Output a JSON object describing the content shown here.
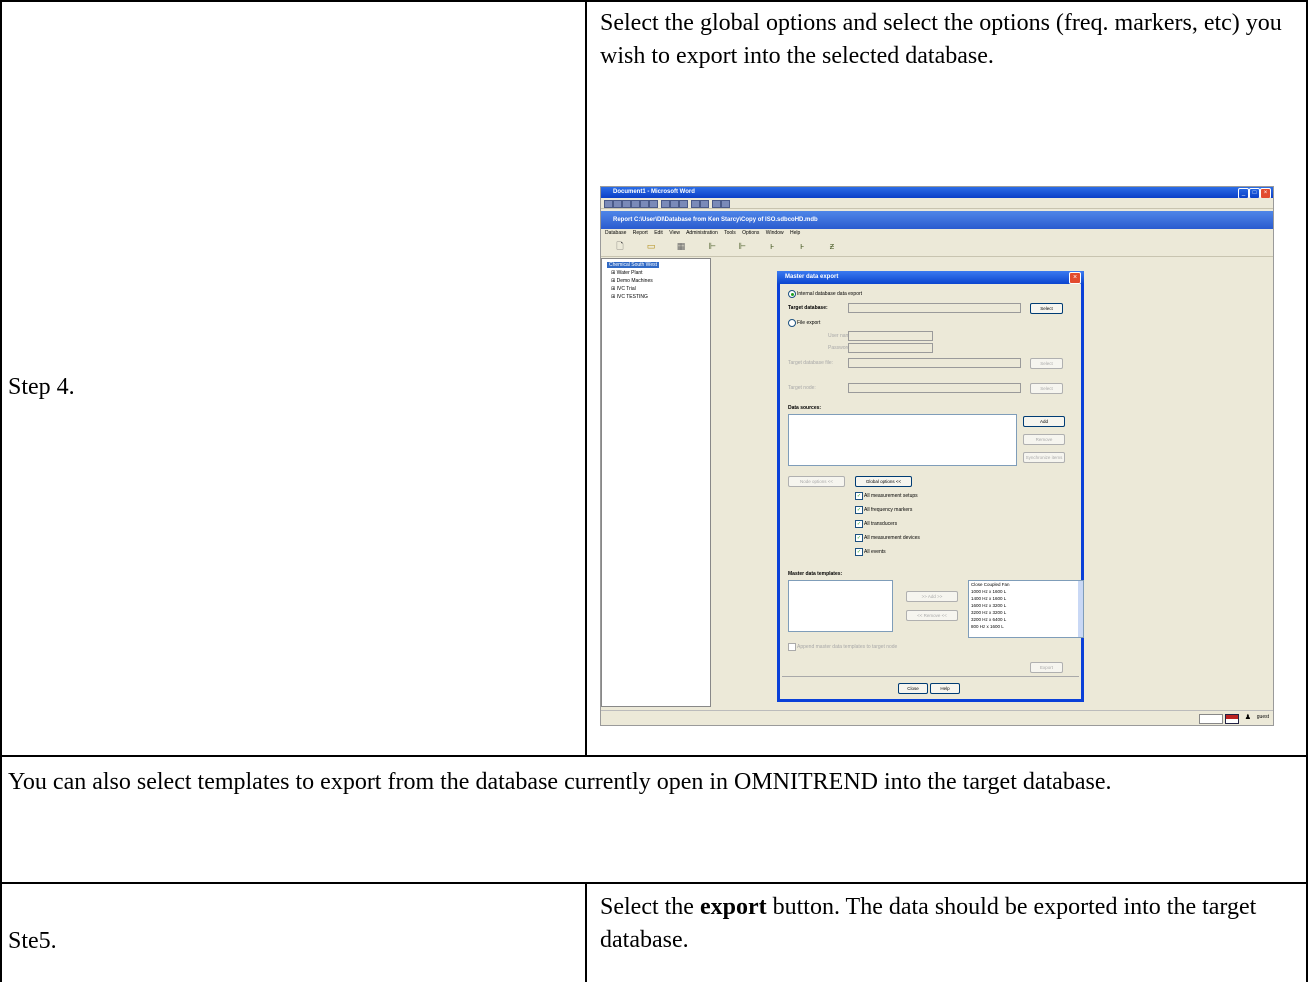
{
  "step4": {
    "label": "Step 4.",
    "instruction": "Select the global options and select the options (freq. markers, etc) you wish to export into the selected database."
  },
  "note": "You can also select templates to export from the database currently open in OMNITREND into the target database.",
  "step5": {
    "label": "Ste5.",
    "instruction_pre": "Select the ",
    "instruction_bold": "export",
    "instruction_post": " button.  The data should be exported into the target database."
  },
  "screenshot": {
    "word_title": "Document1 - Microsoft Word",
    "app_title": "Report C:\\User\\DI\\Database from Ken Starcy\\Copy of ISO.sdbcoHD.mdb",
    "menu": [
      "Database",
      "Report",
      "Edit",
      "View",
      "Administration",
      "Tools",
      "Options",
      "Window",
      "Help"
    ],
    "tree": [
      {
        "label": "Chemical South West",
        "selected": true
      },
      {
        "label": "Water Plant",
        "selected": false
      },
      {
        "label": "Demo Machines",
        "selected": false
      },
      {
        "label": "IVC Trial",
        "selected": false
      },
      {
        "label": "IVC TESTING",
        "selected": false
      }
    ],
    "status_user": "guest",
    "dialog": {
      "title": "Master data export",
      "internal_export": "Internal database data export",
      "target_database_label": "Target database:",
      "select": "Select",
      "file_export": "File export",
      "user_name": "User name:",
      "password": "Password:",
      "target_db_file": "Target database file:",
      "target_node": "Target node:",
      "data_sources": "Data sources:",
      "add": "Add",
      "remove": "Remove",
      "synchronize": "Synchronize items",
      "node_options": "Node options <<",
      "global_options": "Global options <<",
      "checks": [
        "All measurement setups",
        "All frequency markers",
        "All transducers",
        "All measurement devices",
        "All events"
      ],
      "master_templates": "Master data templates:",
      "add_arrow": ">> Add >>",
      "remove_arrow": "<< Remove <<",
      "templates": [
        "Close Coupled Fan",
        "1000 Hz x 1600 L",
        "1400 Hz x 1600 L",
        "1600 Hz x 3200 L",
        "3200 Hz x 3200 L",
        "3200 Hz x 6400 L",
        "800 Hz x 1600 L"
      ],
      "append_label": "Append master data templates to target node",
      "export": "Export",
      "close": "Close",
      "help": "Help"
    }
  }
}
